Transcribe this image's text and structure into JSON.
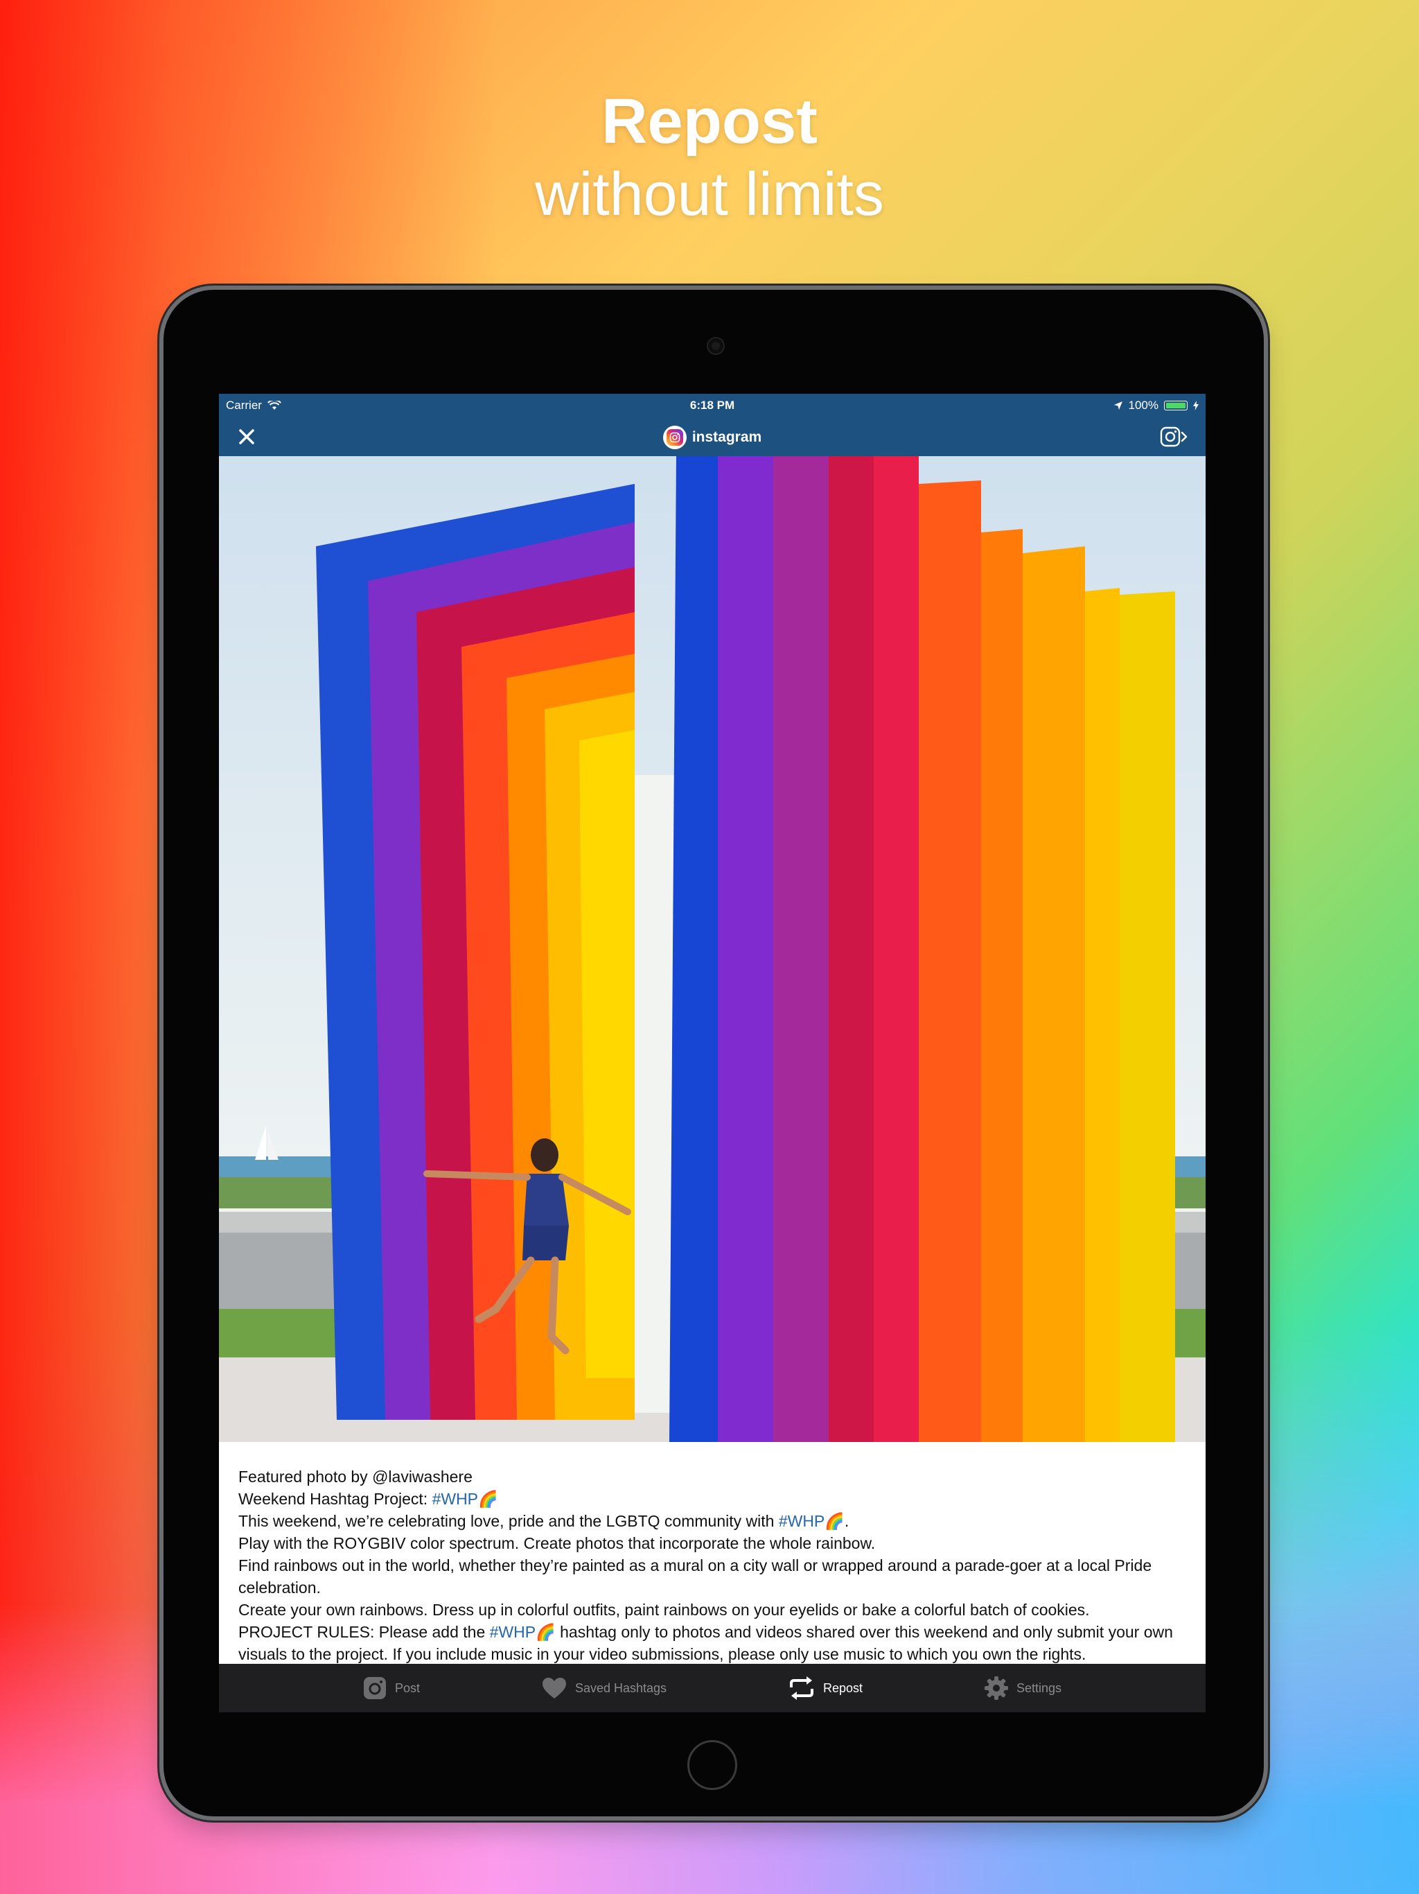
{
  "promo": {
    "title": "Repost",
    "subtitle": "without limits"
  },
  "status_bar": {
    "carrier": "Carrier",
    "time": "6:18 PM",
    "battery": "100%"
  },
  "nav": {
    "account_name": "instagram"
  },
  "caption": {
    "line1": "Featured photo by @laviwashere",
    "line2_prefix": "Weekend Hashtag Project: ",
    "hashtag": "#WHP🌈",
    "line3_prefix": "This weekend, we’re celebrating love, pride and the LGBTQ community with ",
    "line3_suffix": ".",
    "line4": "Play with the ROYGBIV color spectrum. Create photos that incorporate the whole rainbow.",
    "line5": "Find rainbows out in the world, whether they’re painted as a mural on a city wall or wrapped around a parade-goer at a local Pride celebration.",
    "line6": "Create your own rainbows. Dress up in colorful outfits, paint rainbows on your eyelids or bake a colorful batch of cookies.",
    "line7_prefix": "PROJECT RULES: Please add the ",
    "line7_suffix": " hashtag only to photos and videos shared over this weekend and only submit your own visuals to the project. If you include music in your video submissions, please only use music to which you own the rights."
  },
  "tabs": [
    {
      "label": "Post",
      "icon": "camera-icon"
    },
    {
      "label": "Saved Hashtags",
      "icon": "heart-icon"
    },
    {
      "label": "Repost",
      "icon": "repost-icon"
    },
    {
      "label": "Settings",
      "icon": "gear-icon"
    }
  ],
  "active_tab": "Repost",
  "colors": {
    "nav_bar": "#1d5180",
    "hashtag": "#2466a8",
    "tab_bar": "#1f1f21"
  }
}
